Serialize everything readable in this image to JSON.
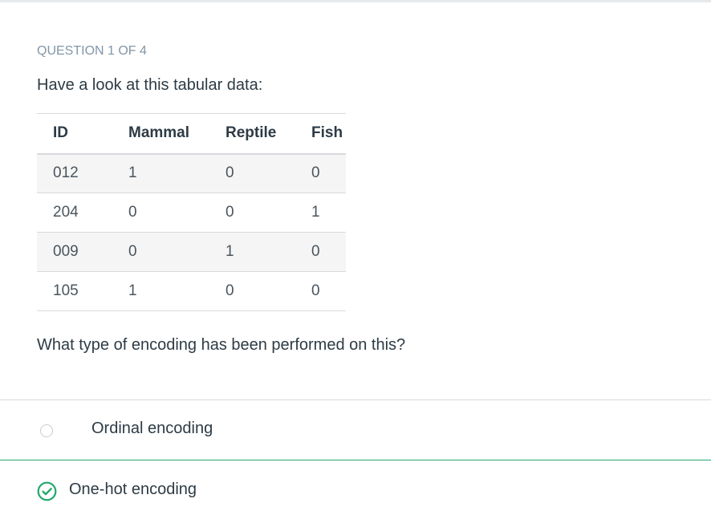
{
  "quiz": {
    "progress_label": "QUESTION 1 OF 4",
    "prompt": "Have a look at this tabular data:",
    "question": "What type of encoding has been performed on this?"
  },
  "table": {
    "headers": [
      "ID",
      "Mammal",
      "Reptile",
      "Fish"
    ],
    "rows": [
      [
        "012",
        "1",
        "0",
        "0"
      ],
      [
        "204",
        "0",
        "0",
        "1"
      ],
      [
        "009",
        "0",
        "1",
        "0"
      ],
      [
        "105",
        "1",
        "0",
        "0"
      ]
    ]
  },
  "answers": [
    {
      "label": "Ordinal encoding",
      "selected": false,
      "icon": "radio-unselected-icon"
    },
    {
      "label": "One-hot encoding",
      "selected": true,
      "icon": "check-circle-icon"
    }
  ],
  "colors": {
    "accent_green": "#20a86b",
    "muted_label": "#8296a8",
    "text": "#2d3b45",
    "divider": "#d7dadd",
    "row_stripe": "#f5f5f5"
  }
}
